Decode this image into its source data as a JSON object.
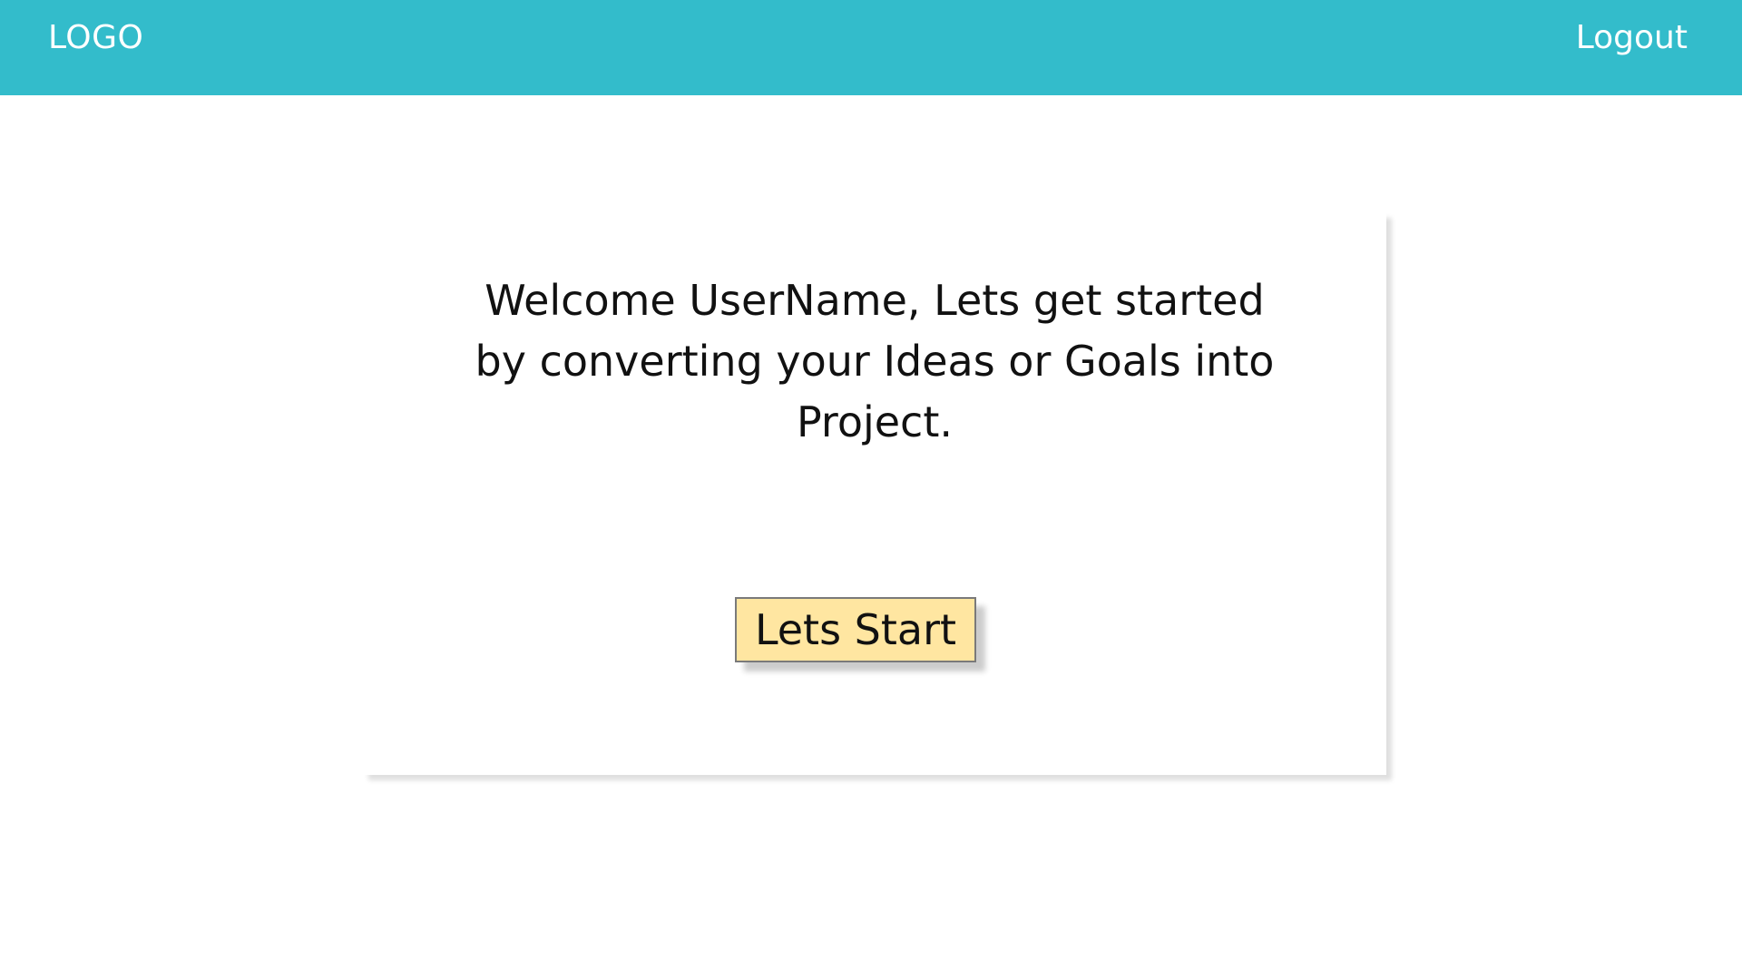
{
  "header": {
    "logo_text": "LOGO",
    "logout_label": "Logout",
    "background_color": "#33bccb"
  },
  "main": {
    "welcome_message": "Welcome UserName, Lets get started by converting your Ideas or Goals into Project.",
    "start_button_label": "Lets Start",
    "start_button_color": "#ffe6a1"
  }
}
